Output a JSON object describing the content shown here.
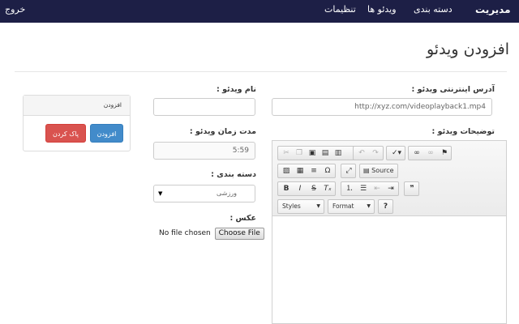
{
  "nav": {
    "brand": "مدیریت",
    "categories": "دسته بندی",
    "videos": "ویدئو ها",
    "settings": "تنظیمات",
    "logout": "خروج"
  },
  "page": {
    "title": "افزودن ویدئو"
  },
  "form": {
    "url_label": "آدرس اینترنتی ویدئو :",
    "url_value": "http://xyz.com/videoplayback1.mp4",
    "name_label": "نام ویدئو :",
    "name_value": "",
    "duration_label": "مدت زمان ویدئو :",
    "duration_value": "5:59",
    "category_label": "دسته بندی :",
    "category_selected": "ورزشی",
    "image_label": "عکس :",
    "file_status": "No file chosen",
    "file_button": "Choose File",
    "description_label": "توضیحات ویدئو :"
  },
  "editor": {
    "source_label": "Source",
    "styles_label": "Styles",
    "format_label": "Format",
    "help_label": "?"
  },
  "panel": {
    "heading": "افزودن",
    "add_button": "افزودن",
    "clear_button": "پاک کردن"
  },
  "colors": {
    "navbar": "#1d1f46",
    "primary": "#428bca",
    "danger": "#d9534f"
  }
}
